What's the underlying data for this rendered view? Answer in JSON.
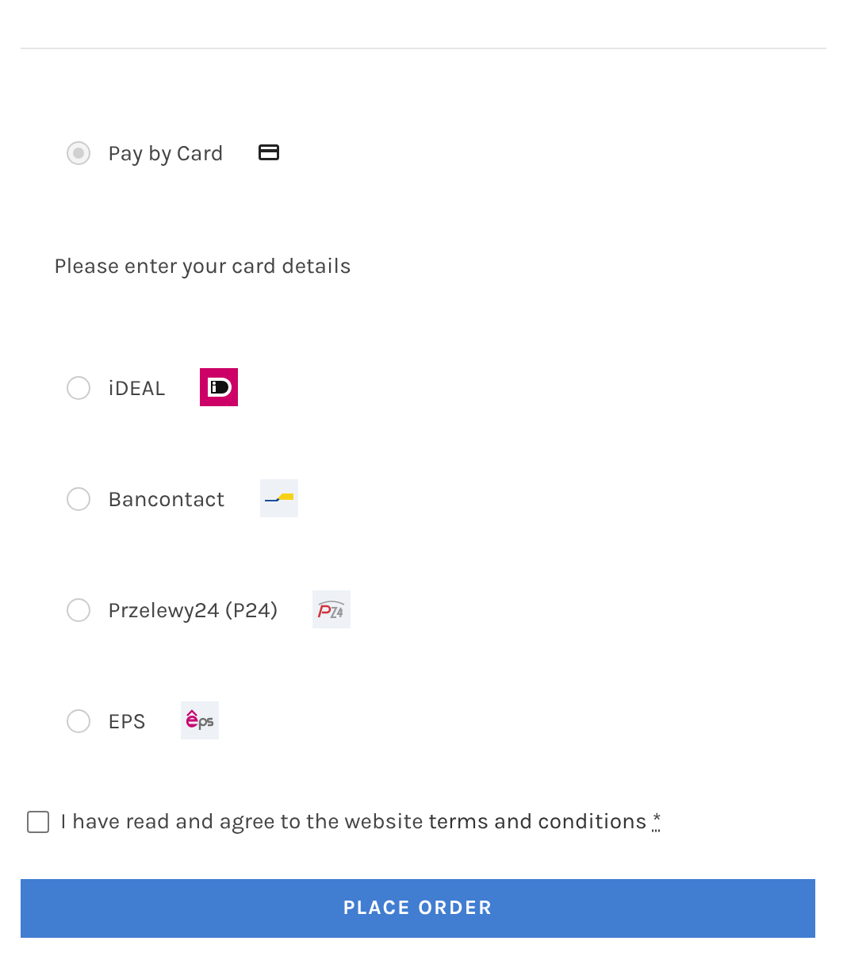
{
  "payment_methods": [
    {
      "label": "Pay by Card",
      "selected": true,
      "kind": "card",
      "details": "Please enter your card details"
    },
    {
      "label": "iDEAL",
      "selected": false,
      "kind": "ideal"
    },
    {
      "label": "Bancontact",
      "selected": false,
      "kind": "bancontact"
    },
    {
      "label": "Przelewy24 (P24)",
      "selected": false,
      "kind": "p24"
    },
    {
      "label": "EPS",
      "selected": false,
      "kind": "eps"
    }
  ],
  "terms": {
    "checked": false,
    "text": "I have read and agree to the website",
    "link": "terms and conditions",
    "required_mark": "*"
  },
  "place_order_button": "PLACE ORDER"
}
